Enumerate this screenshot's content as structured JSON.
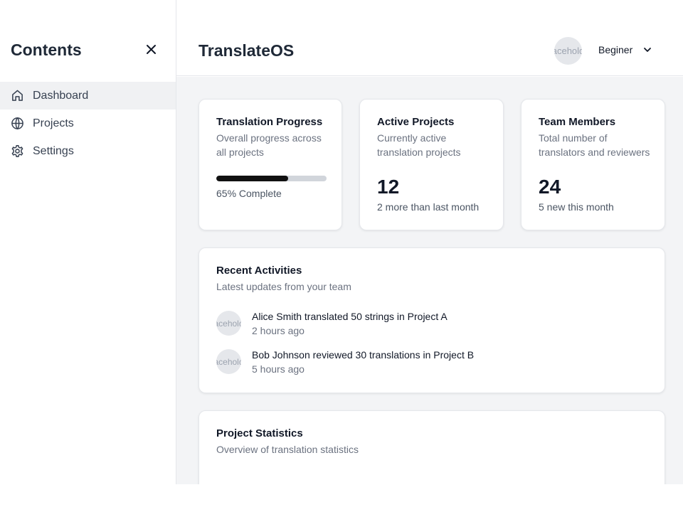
{
  "sidebar": {
    "title": "Contents",
    "items": [
      {
        "label": "Dashboard",
        "icon": "home-icon",
        "active": true
      },
      {
        "label": "Projects",
        "icon": "globe-icon",
        "active": false
      },
      {
        "label": "Settings",
        "icon": "gear-icon",
        "active": false
      }
    ]
  },
  "header": {
    "app_title": "TranslateOS",
    "avatar_text": "Placeholder",
    "user_level": "Beginer"
  },
  "cards": {
    "progress": {
      "title": "Translation Progress",
      "description": "Overall progress across all projects",
      "value": 65,
      "label": "65% Complete"
    },
    "projects": {
      "title": "Active Projects",
      "description": "Currently active translation projects",
      "value": "12",
      "note": "2 more than last month"
    },
    "team": {
      "title": "Team Members",
      "description": "Total number of translators and reviewers",
      "value": "24",
      "note": "5 new this month"
    }
  },
  "activities": {
    "title": "Recent Activities",
    "description": "Latest updates from your team",
    "items": [
      {
        "avatar_text": "Placeholder",
        "text": "Alice Smith translated 50 strings in Project A",
        "time": "2 hours ago"
      },
      {
        "avatar_text": "Placeholder",
        "text": "Bob Johnson reviewed 30 translations in Project B",
        "time": "5 hours ago"
      }
    ]
  },
  "statistics": {
    "title": "Project Statistics",
    "description": "Overview of translation statistics"
  },
  "colors": {
    "accent": "#111111",
    "track": "#d1d5db",
    "background": "#f3f4f6"
  }
}
